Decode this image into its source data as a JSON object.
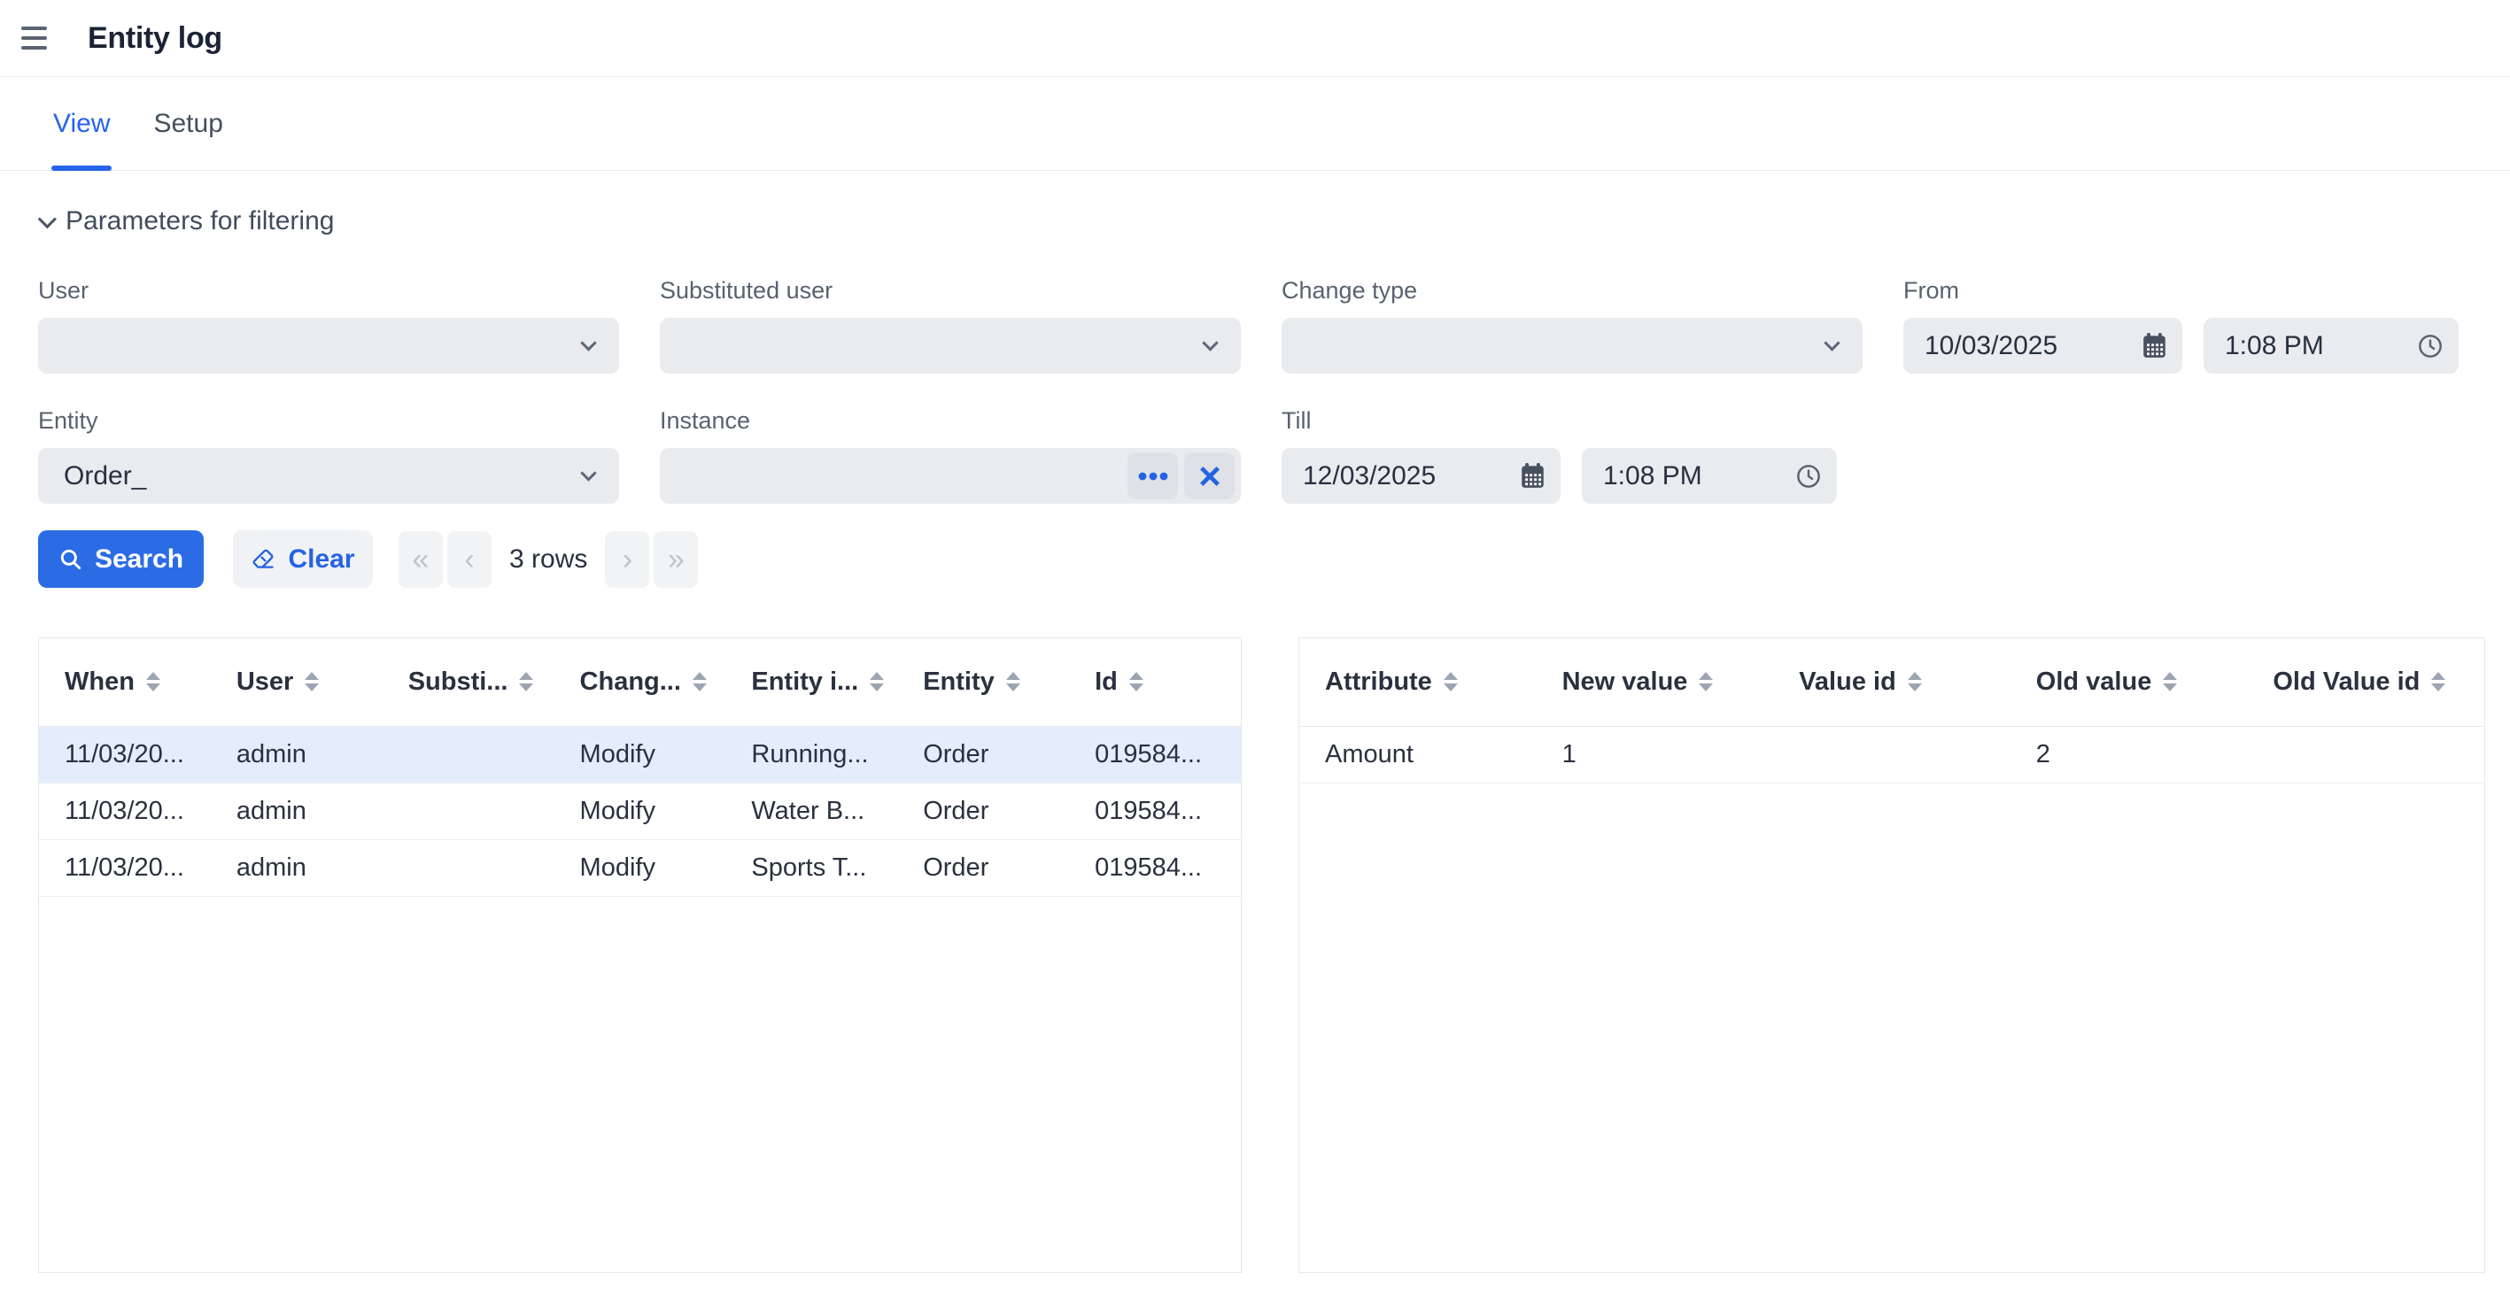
{
  "header": {
    "title": "Entity log"
  },
  "tabs": [
    {
      "label": "View",
      "active": true
    },
    {
      "label": "Setup",
      "active": false
    }
  ],
  "filters": {
    "section_title": "Parameters for filtering",
    "user_label": "User",
    "user_value": "",
    "substituted_user_label": "Substituted user",
    "substituted_user_value": "",
    "change_type_label": "Change type",
    "change_type_value": "",
    "from_label": "From",
    "from_date": "10/03/2025",
    "from_time": "1:08 PM",
    "entity_label": "Entity",
    "entity_value": "Order_",
    "instance_label": "Instance",
    "instance_value": "",
    "till_label": "Till",
    "till_date": "12/03/2025",
    "till_time": "1:08 PM"
  },
  "toolbar": {
    "search_label": "Search",
    "clear_label": "Clear",
    "rows_count": "3 rows",
    "pagination": {
      "first": "«",
      "prev": "‹",
      "next": "›",
      "last": "»"
    }
  },
  "log_table": {
    "columns": [
      "When",
      "User",
      "Substi...",
      "Chang...",
      "Entity i...",
      "Entity",
      "Id"
    ],
    "rows": [
      {
        "selected": true,
        "cells": [
          "11/03/20...",
          "admin",
          "",
          "Modify",
          "Running...",
          "Order",
          "019584..."
        ]
      },
      {
        "selected": false,
        "cells": [
          "11/03/20...",
          "admin",
          "",
          "Modify",
          "Water B...",
          "Order",
          "019584..."
        ]
      },
      {
        "selected": false,
        "cells": [
          "11/03/20...",
          "admin",
          "",
          "Modify",
          "Sports T...",
          "Order",
          "019584..."
        ]
      }
    ]
  },
  "detail_table": {
    "columns": [
      "Attribute",
      "New value",
      "Value id",
      "Old value",
      "Old Value id"
    ],
    "rows": [
      {
        "selected": false,
        "cells": [
          "Amount",
          "1",
          "",
          "2",
          ""
        ]
      }
    ]
  },
  "colors": {
    "accent": "#2b6ce4",
    "tab_active": "#2563eb",
    "selected_row": "#e3edfb",
    "field_bg": "#e9ebee"
  }
}
